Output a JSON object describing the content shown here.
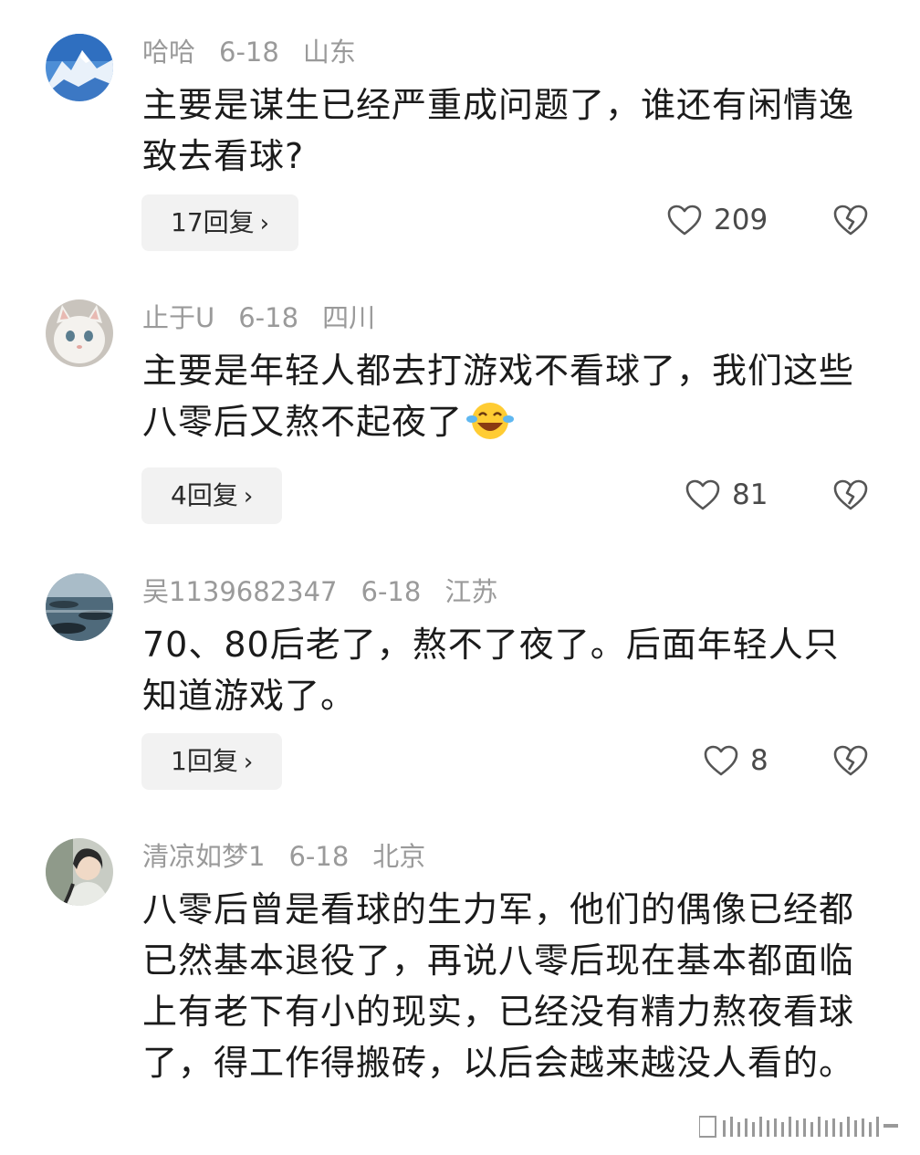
{
  "comments": [
    {
      "user": "哈哈",
      "date": "6-18",
      "location": "山东",
      "text": "主要是谋生已经严重成问题了，谁还有闲情逸致去看球?",
      "replies": "17回复",
      "likes": "209",
      "avatar": "mountain-avatar"
    },
    {
      "user": "止于U",
      "date": "6-18",
      "location": "四川",
      "text": "主要是年轻人都去打游戏不看球了，我们这些八零后又熬不起夜了",
      "emoji": "laughing-emoji",
      "replies": "4回复",
      "likes": "81",
      "avatar": "cat-avatar"
    },
    {
      "user": "吴1139682347",
      "date": "6-18",
      "location": "江苏",
      "text": "70、80后老了，熬不了夜了。后面年轻人只知道游戏了。",
      "replies": "1回复",
      "likes": "8",
      "avatar": "sea-avatar"
    },
    {
      "user": "清凉如梦1",
      "date": "6-18",
      "location": "北京",
      "text": "八零后曾是看球的生力军，他们的偶像已经都已然基本退役了，再说八零后现在基本都面临上有老下有小的现实，已经没有精力熬夜看球了，得工作得搬砖，以后会越来越没人看的。",
      "avatar": "person-avatar"
    }
  ],
  "reply_chevron": "›",
  "icons": {
    "like": "heart-icon",
    "dislike": "broken-heart-icon"
  },
  "colors": {
    "meta": "#9a9a9a",
    "reply_bg": "#f2f2f2",
    "text": "#1b1b1b"
  }
}
